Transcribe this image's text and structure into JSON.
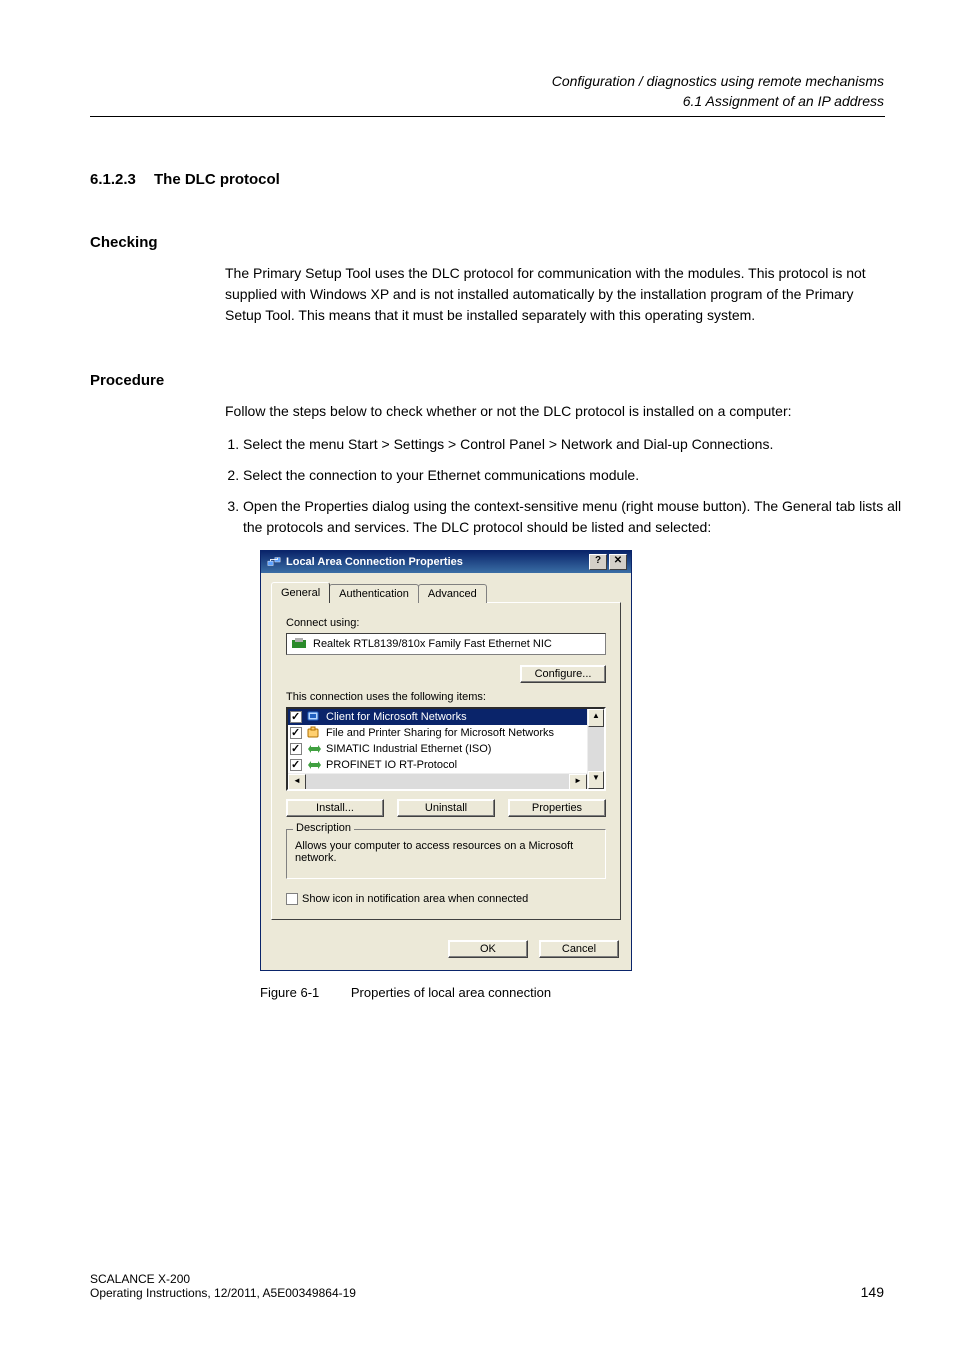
{
  "header": {
    "title": "Configuration / diagnostics using remote mechanisms",
    "subtitle": "6.1 Assignment of an IP address"
  },
  "section": {
    "number": "6.1.2.3",
    "title": "The DLC protocol"
  },
  "checking": {
    "heading": "Checking",
    "body": "The Primary Setup Tool uses the DLC protocol for communication with the modules. This protocol is not supplied with Windows XP and is not installed automatically by the installation program of the Primary Setup Tool. This means that it must be installed separately with this operating system."
  },
  "procedure": {
    "heading": "Procedure",
    "intro": "Follow the steps below to check whether or not the DLC protocol is installed on a computer:",
    "steps": [
      "Select the menu Start > Settings > Control Panel > Network and Dial-up Connections.",
      "Select the connection to your Ethernet communications module.",
      "Open the Properties dialog using the context-sensitive menu (right mouse button). The General tab lists all the protocols and services. The DLC protocol should be listed and selected:"
    ]
  },
  "dialog": {
    "title": "Local Area Connection Properties",
    "help_glyph": "?",
    "close_glyph": "✕",
    "tabs": [
      "General",
      "Authentication",
      "Advanced"
    ],
    "connect_label": "Connect using:",
    "nic": "Realtek RTL8139/810x Family Fast Ethernet NIC",
    "configure": "Configure...",
    "items_label": "This connection uses the following items:",
    "items": [
      {
        "checked": true,
        "label": "Client for Microsoft Networks",
        "selected": true
      },
      {
        "checked": true,
        "label": "File and Printer Sharing for Microsoft Networks",
        "selected": false
      },
      {
        "checked": true,
        "label": "SIMATIC Industrial Ethernet (ISO)",
        "selected": false
      },
      {
        "checked": true,
        "label": "PROFINET IO RT-Protocol",
        "selected": false
      }
    ],
    "scroll_up": "▲",
    "scroll_down": "▼",
    "scroll_left": "◄",
    "scroll_right": "►",
    "install": "Install...",
    "uninstall": "Uninstall",
    "properties": "Properties",
    "description_legend": "Description",
    "description": "Allows your computer to access resources on a Microsoft network.",
    "show_icon": "Show icon in notification area when connected",
    "ok": "OK",
    "cancel": "Cancel"
  },
  "caption": {
    "num": "Figure 6-1",
    "text": "Properties of local area connection"
  },
  "footer": {
    "line1": "SCALANCE X-200",
    "line2": "Operating Instructions, 12/2011, A5E00349864-19",
    "page": "149"
  }
}
